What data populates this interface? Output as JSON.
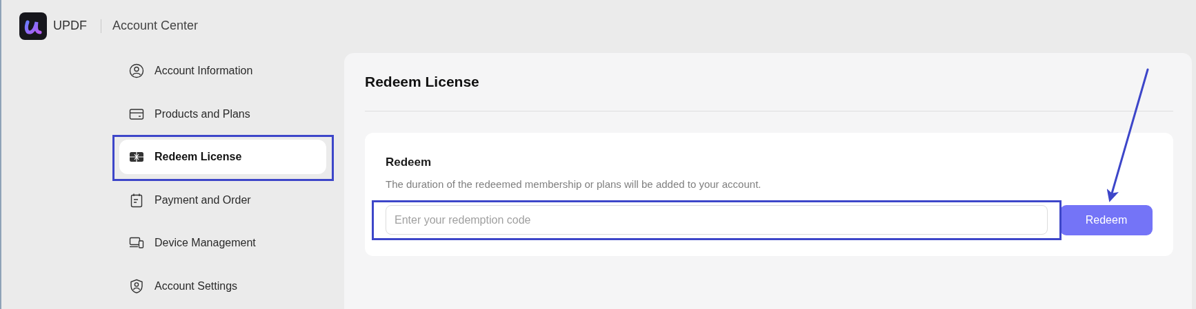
{
  "header": {
    "brand": "UPDF",
    "title": "Account Center"
  },
  "sidebar": {
    "items": [
      {
        "label": "Account Information",
        "selected": false
      },
      {
        "label": "Products and Plans",
        "selected": false
      },
      {
        "label": "Redeem License",
        "selected": true
      },
      {
        "label": "Payment and Order",
        "selected": false
      },
      {
        "label": "Device Management",
        "selected": false
      },
      {
        "label": "Account Settings",
        "selected": false
      }
    ]
  },
  "main": {
    "title": "Redeem License",
    "card": {
      "title": "Redeem",
      "description": "The duration of the redeemed membership or plans will be added to your account.",
      "input": {
        "placeholder": "Enter your redemption code"
      },
      "button": "Redeem"
    }
  }
}
